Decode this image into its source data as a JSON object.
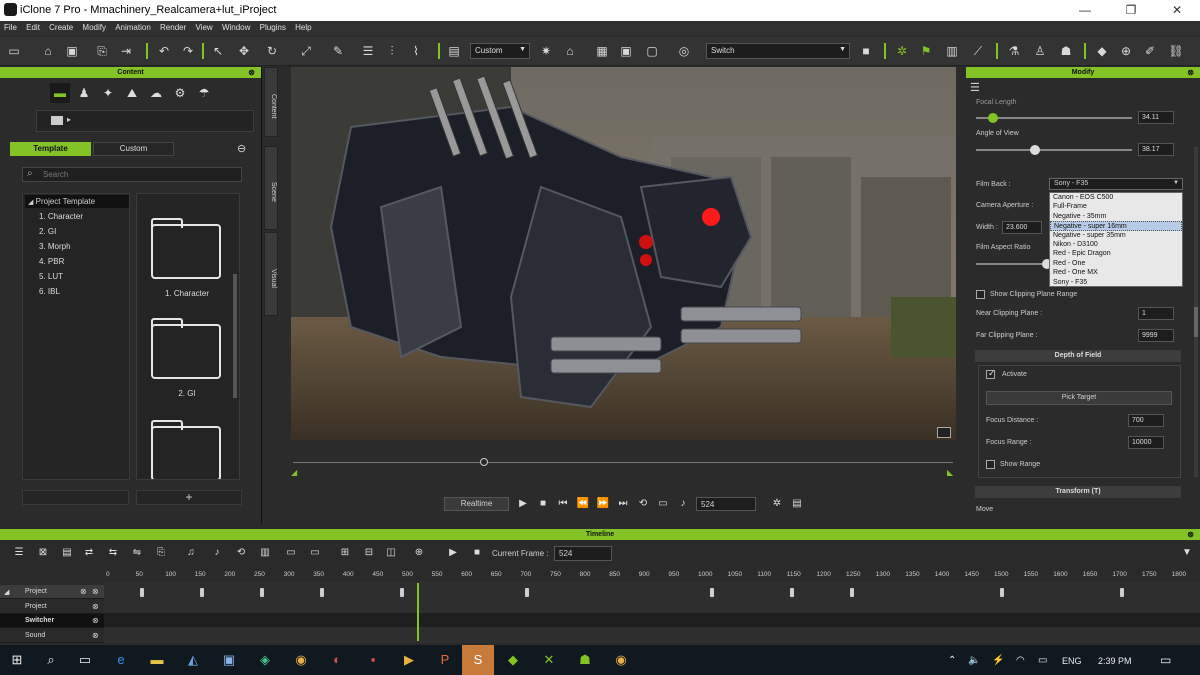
{
  "window": {
    "title": "iClone 7 Pro - Mmachinery_Realcamera+lut_iProject",
    "controls": [
      "—",
      "❐",
      "✕"
    ]
  },
  "menu": [
    "File",
    "Edit",
    "Create",
    "Modify",
    "Animation",
    "Render",
    "View",
    "Window",
    "Plugins",
    "Help"
  ],
  "toolbar": {
    "view_combo": "Custom",
    "camera_combo": "Switch"
  },
  "content_panel": {
    "title": "Content",
    "tabs": [
      "Template",
      "Custom"
    ],
    "search_placeholder": "Search",
    "side_tabs": [
      "Content",
      "Scene",
      "Visual"
    ],
    "tree": {
      "root": "Project Template",
      "items": [
        "1. Character",
        "2. GI",
        "3. Morph",
        "4. PBR",
        "5. LUT",
        "6. IBL"
      ]
    },
    "tiles": [
      "1. Character",
      "2. GI"
    ],
    "add_label": "+"
  },
  "playback": {
    "mode": "Realtime",
    "frame": "524"
  },
  "modify_panel": {
    "title": "Modify",
    "focal_length_label": "Focal Length",
    "focal_length": "34.11",
    "angle_of_view_label": "Angle of View",
    "angle_of_view": "38.17",
    "film_back_label": "Film Back :",
    "film_back_value": "Sony - F35",
    "film_back_options": [
      "Canon - EOS C500",
      "Full-Frame",
      "Negative - 35mm",
      "Negative - super 16mm",
      "Negative - super 35mm",
      "Nikon - D3100",
      "Red - Epic Dragon",
      "Red - One",
      "Red - One MX",
      "Sony - F35"
    ],
    "film_back_selected": "Negative - super 16mm",
    "camera_aperture_label": "Camera Aperture :",
    "width_label": "Width :",
    "width_value": "23.600",
    "film_aspect_label": "Film Aspect Ratio",
    "show_clip_label": "Show Clipping Plane Range",
    "near_clip_label": "Near Clipping Plane :",
    "near_clip": "1",
    "far_clip_label": "Far Clipping Plane :",
    "far_clip": "9999",
    "dof_title": "Depth of Field",
    "activate_label": "Activate",
    "pick_target_label": "Pick Target",
    "focus_distance_label": "Focus Distance :",
    "focus_distance": "700",
    "focus_range_label": "Focus Range :",
    "focus_range": "10000",
    "show_range_label": "Show Range",
    "transform_title": "Transform  (T)",
    "move_label": "Move"
  },
  "timeline": {
    "title": "Timeline",
    "current_frame_label": "Current Frame :",
    "current_frame": "524",
    "ticks": [
      "0",
      "50",
      "100",
      "150",
      "200",
      "250",
      "300",
      "350",
      "400",
      "450",
      "500",
      "550",
      "600",
      "650",
      "700",
      "750",
      "800",
      "850",
      "900",
      "950",
      "1000",
      "1050",
      "1100",
      "1150",
      "1200",
      "1250",
      "1300",
      "1350",
      "1400",
      "1450",
      "1500",
      "1550",
      "1600",
      "1650",
      "1700",
      "1750",
      "1800"
    ],
    "tracks": [
      "Project",
      "Project",
      "Switcher",
      "Sound"
    ]
  },
  "taskbar": {
    "language": "ENG",
    "time": "2:39 PM"
  },
  "colors": {
    "accent": "#83c325",
    "panel": "#2b2b2b",
    "taskbar": "#101820"
  }
}
